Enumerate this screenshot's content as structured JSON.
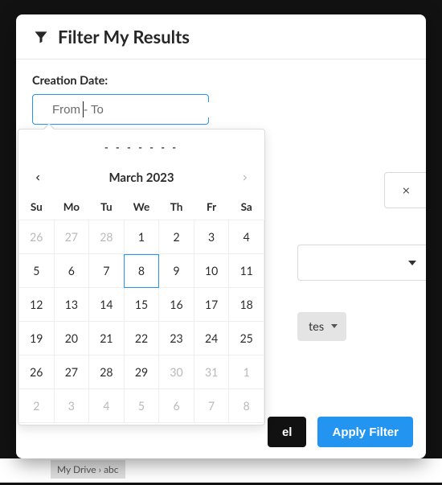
{
  "modal": {
    "title": "Filter My Results",
    "field_label": "Creation Date:",
    "date_placeholder": "From - To",
    "range_display": "- - - - - - -",
    "cancel_label": "el",
    "apply_label": "Apply Filter"
  },
  "behind": {
    "pill_label": "tes"
  },
  "calendar": {
    "month_label": "March 2023",
    "dow": [
      "Su",
      "Mo",
      "Tu",
      "We",
      "Th",
      "Fr",
      "Sa"
    ],
    "today_index": 10,
    "cells": [
      {
        "d": "26",
        "out": true
      },
      {
        "d": "27",
        "out": true
      },
      {
        "d": "28",
        "out": true
      },
      {
        "d": "1"
      },
      {
        "d": "2"
      },
      {
        "d": "3"
      },
      {
        "d": "4"
      },
      {
        "d": "5"
      },
      {
        "d": "6"
      },
      {
        "d": "7"
      },
      {
        "d": "8"
      },
      {
        "d": "9"
      },
      {
        "d": "10"
      },
      {
        "d": "11"
      },
      {
        "d": "12"
      },
      {
        "d": "13"
      },
      {
        "d": "14"
      },
      {
        "d": "15"
      },
      {
        "d": "16"
      },
      {
        "d": "17"
      },
      {
        "d": "18"
      },
      {
        "d": "19"
      },
      {
        "d": "20"
      },
      {
        "d": "21"
      },
      {
        "d": "22"
      },
      {
        "d": "23"
      },
      {
        "d": "24"
      },
      {
        "d": "25"
      },
      {
        "d": "26"
      },
      {
        "d": "27"
      },
      {
        "d": "28"
      },
      {
        "d": "29"
      },
      {
        "d": "30",
        "out": true
      },
      {
        "d": "31",
        "out": true
      },
      {
        "d": "1",
        "out": true
      },
      {
        "d": "2",
        "out": true
      },
      {
        "d": "3",
        "out": true
      },
      {
        "d": "4",
        "out": true
      },
      {
        "d": "5",
        "out": true
      },
      {
        "d": "6",
        "out": true
      },
      {
        "d": "7",
        "out": true
      },
      {
        "d": "8",
        "out": true
      }
    ]
  },
  "breadcrumb": "My Drive   ›   abc"
}
